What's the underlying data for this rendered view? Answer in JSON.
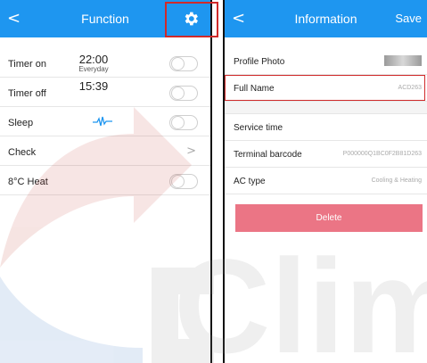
{
  "left": {
    "title": "Function",
    "rows": [
      {
        "label": "Timer on",
        "time": "22:00",
        "sub": "Everyday"
      },
      {
        "label": "Timer off",
        "time": "15:39",
        "sub": ""
      },
      {
        "label": "Sleep"
      },
      {
        "label": "Check"
      },
      {
        "label": "8°C Heat"
      }
    ]
  },
  "right": {
    "title": "Information",
    "save_label": "Save",
    "rows": [
      {
        "label": "Profile Photo",
        "value": ""
      },
      {
        "label": "Full Name",
        "value": "ACD263"
      },
      {
        "label": "Service time",
        "value": ""
      },
      {
        "label": "Terminal barcode",
        "value": "P000000Q1BC0F2B81D263"
      },
      {
        "label": "AC type",
        "value": "Cooling & Heating"
      }
    ],
    "delete_label": "Delete"
  },
  "watermark": "Clima",
  "colors": {
    "header": "#1e96f0",
    "delete": "#eb7585",
    "highlight": "#d02a2a"
  }
}
